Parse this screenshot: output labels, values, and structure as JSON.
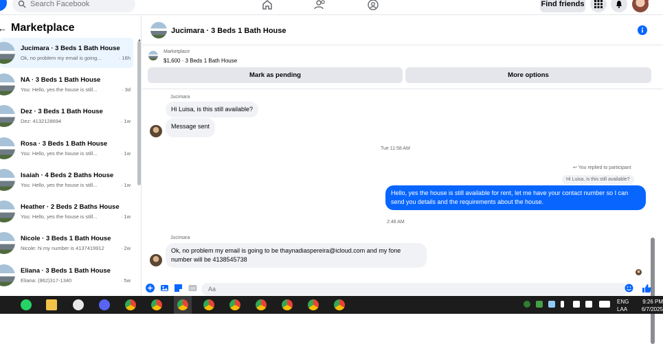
{
  "topbar": {
    "search_placeholder": "Search Facebook",
    "find_friends": "Find friends"
  },
  "sidebar": {
    "title": "Marketplace",
    "conversations": [
      {
        "title": "Jucimara · 3 Beds 1 Bath House",
        "preview": "Ok, no problem my email is going...",
        "time": "· 16h",
        "active": true
      },
      {
        "title": "NA · 3 Beds 1 Bath House",
        "preview": "You: Hello, yes the house is still...",
        "time": "· 3d"
      },
      {
        "title": "Dez · 3 Beds 1 Bath House",
        "preview": "Dez: 4132128694",
        "time": "· 1w"
      },
      {
        "title": "Rosa · 3 Beds 1 Bath House",
        "preview": "You: Hello, yes the house is still...",
        "time": "· 1w"
      },
      {
        "title": "Isaiah · 4 Beds 2 Baths House",
        "preview": "You: Hello, yes the house is still...",
        "time": "· 1w"
      },
      {
        "title": "Heather · 2 Beds 2 Baths House",
        "preview": "You: Hello, yes the house is still...",
        "time": "· 1w"
      },
      {
        "title": "Nicole · 3 Beds 1 Bath House",
        "preview": "Nicole: hi my number is 4137419912",
        "time": "· 2w"
      },
      {
        "title": "Eliana · 3 Beds 1 Bath House",
        "preview": "Eliana: (862)317-1340",
        "time": "· 5w"
      }
    ]
  },
  "chat": {
    "title": "Jucimara · 3 Beds 1 Bath House",
    "listing_label": "Marketplace",
    "listing_price": "$1,600 · 3 Beds 1 Bath House",
    "mark_pending": "Mark as pending",
    "more_options": "More options",
    "sender1": "Jucimara",
    "msg1": "Hi Luisa, is this still available?",
    "msg2": "Message sent",
    "ts1": "Tue 11:58 AM",
    "replied": "You replied to participant",
    "reply_quote": "Hi Luisa, is this still available?",
    "msg_out": "Hello, yes the house is still available for rent, let me have your contact number so I can send you details and the requirements about the house.",
    "ts2": "2:48 AM",
    "sender2": "Jucimara",
    "msg3": "Ok, no problem my email is going to be thaynadiaspereira@icloud.com and my fone number will be 4138545738",
    "composer_placeholder": "Aa"
  },
  "taskbar": {
    "lang1": "ENG",
    "lang2": "LAA",
    "time": "9:26 PM",
    "date": "6/7/2025"
  },
  "colors": {
    "accent": "#0866ff",
    "bubble_in": "#f0f2f5",
    "active_conv": "#ebf5ff",
    "taskbar": "#1c1c1c"
  }
}
